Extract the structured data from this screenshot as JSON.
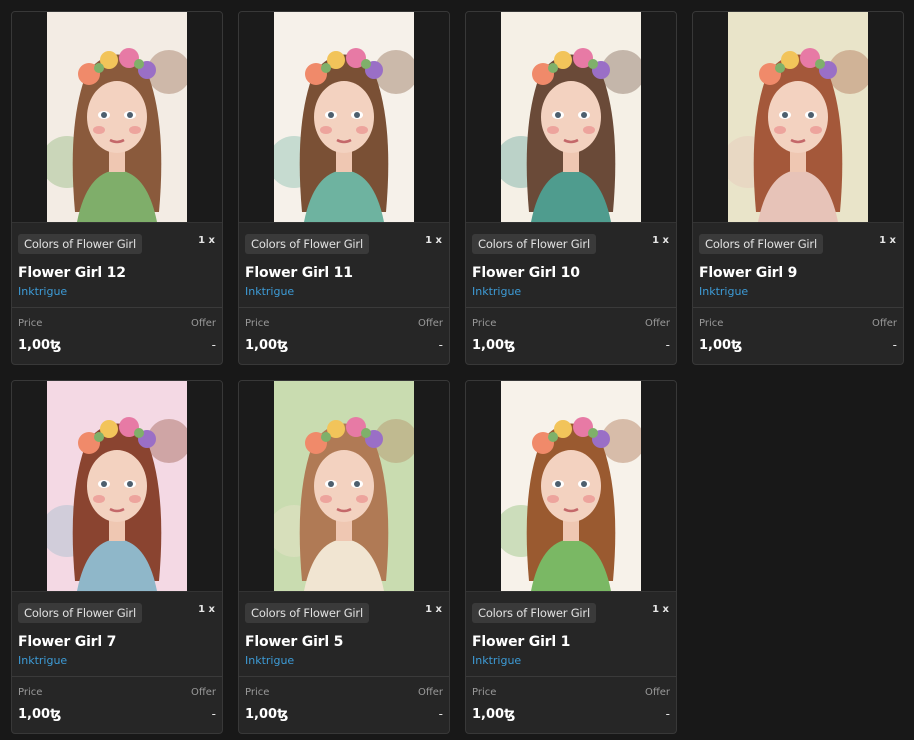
{
  "cards": [
    {
      "collection": "Colors of Flower Girl",
      "quantity": "1 x",
      "name": "Flower Girl 12",
      "creator": "Inktrigue",
      "price_label": "Price",
      "price": "1,00ꜩ",
      "offer_label": "Offer",
      "offer": "-",
      "hair_color": "#8a5a3c",
      "dress_color": "#7fae6a",
      "bg_color": "#f3ece4"
    },
    {
      "collection": "Colors of Flower Girl",
      "quantity": "1 x",
      "name": "Flower Girl 11",
      "creator": "Inktrigue",
      "price_label": "Price",
      "price": "1,00ꜩ",
      "offer_label": "Offer",
      "offer": "-",
      "hair_color": "#7a5035",
      "dress_color": "#6eb3a0",
      "bg_color": "#f6f1ea"
    },
    {
      "collection": "Colors of Flower Girl",
      "quantity": "1 x",
      "name": "Flower Girl 10",
      "creator": "Inktrigue",
      "price_label": "Price",
      "price": "1,00ꜩ",
      "offer_label": "Offer",
      "offer": "-",
      "hair_color": "#6a4a38",
      "dress_color": "#4f9c8e",
      "bg_color": "#f5f0e6"
    },
    {
      "collection": "Colors of Flower Girl",
      "quantity": "1 x",
      "name": "Flower Girl 9",
      "creator": "Inktrigue",
      "price_label": "Price",
      "price": "1,00ꜩ",
      "offer_label": "Offer",
      "offer": "-",
      "hair_color": "#a4583a",
      "dress_color": "#e7c3b8",
      "bg_color": "#e9e4c9"
    },
    {
      "collection": "Colors of Flower Girl",
      "quantity": "1 x",
      "name": "Flower Girl 7",
      "creator": "Inktrigue",
      "price_label": "Price",
      "price": "1,00ꜩ",
      "offer_label": "Offer",
      "offer": "-",
      "hair_color": "#8a4430",
      "dress_color": "#8fb7c9",
      "bg_color": "#f4d9e4"
    },
    {
      "collection": "Colors of Flower Girl",
      "quantity": "1 x",
      "name": "Flower Girl 5",
      "creator": "Inktrigue",
      "price_label": "Price",
      "price": "1,00ꜩ",
      "offer_label": "Offer",
      "offer": "-",
      "hair_color": "#b07a55",
      "dress_color": "#f1e5d2",
      "bg_color": "#c9dcb0"
    },
    {
      "collection": "Colors of Flower Girl",
      "quantity": "1 x",
      "name": "Flower Girl 1",
      "creator": "Inktrigue",
      "price_label": "Price",
      "price": "1,00ꜩ",
      "offer_label": "Offer",
      "offer": "-",
      "hair_color": "#9a5a30",
      "dress_color": "#7ab864",
      "bg_color": "#f7f2ea"
    }
  ]
}
